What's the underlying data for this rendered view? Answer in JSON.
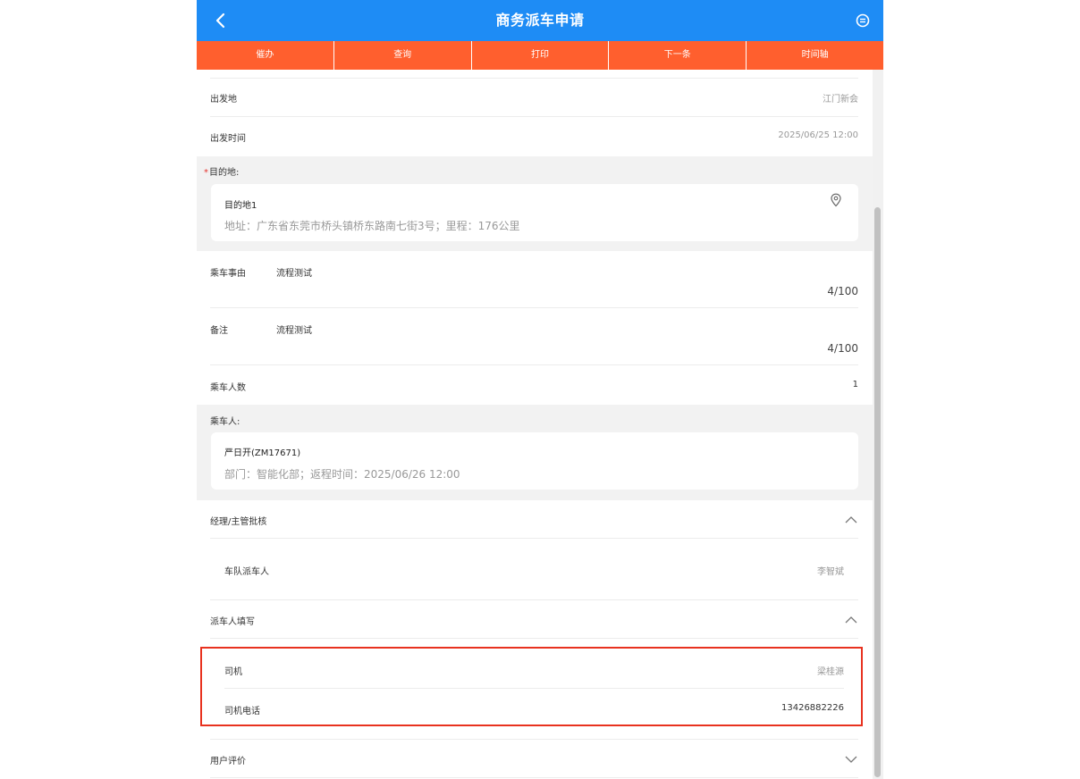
{
  "header": {
    "title": "商务派车申请"
  },
  "actions": [
    "催办",
    "查询",
    "打印",
    "下一条",
    "时间轴"
  ],
  "fields": {
    "departure": {
      "label": "出发地",
      "value": "江门新会"
    },
    "departure_time": {
      "label": "出发时间",
      "value": "2025/06/25 12:00"
    }
  },
  "destination": {
    "required_mark": "*",
    "title": "目的地:",
    "name": "目的地1",
    "detail": "地址：广东省东莞市桥头镇桥东路南七街3号；里程：176公里"
  },
  "reason": {
    "label": "乘车事由",
    "text": "流程测试",
    "count": "4/100"
  },
  "remark": {
    "label": "备注",
    "text": "流程测试",
    "count": "4/100"
  },
  "passenger_count": {
    "label": "乘车人数",
    "value": "1"
  },
  "passengers": {
    "title": "乘车人:",
    "name": "严日开(ZM17671)",
    "detail": "部门：智能化部；返程时间：2025/06/26 12:00"
  },
  "manager_section": {
    "title": "经理/主管批核",
    "dispatcher": {
      "label": "车队派车人",
      "value": "李智斌"
    }
  },
  "dispatcher_section": {
    "title": "派车人填写",
    "driver": {
      "label": "司机",
      "value": "梁桂源"
    },
    "driver_phone": {
      "label": "司机电话",
      "value": "13426882226"
    }
  },
  "rating_section": {
    "title": "用户评价"
  },
  "colors": {
    "header": "#1e8cf5",
    "actions": "#ff5f2e",
    "highlight": "#e8321f",
    "required": "#e5322d"
  }
}
